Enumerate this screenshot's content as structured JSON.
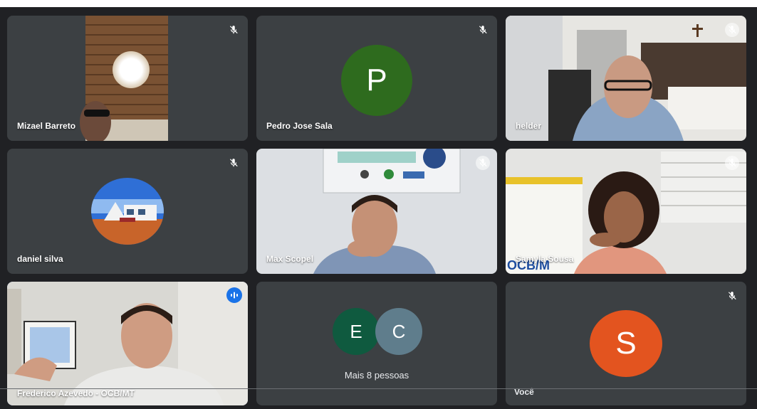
{
  "participants": [
    {
      "name": "Mizael Barreto"
    },
    {
      "name": "Pedro Jose Sala",
      "initial": "P",
      "color": "#2e6b1e"
    },
    {
      "name": "helder"
    },
    {
      "name": "daniel silva"
    },
    {
      "name": "Max Scopel"
    },
    {
      "name": "Samyla Sousa"
    },
    {
      "name": "Frederico Azevedo - OCB/MT"
    },
    {
      "more_label": "Mais 8 pessoas",
      "initials": [
        "E",
        "C"
      ],
      "colors": [
        "#0f5a3f",
        "#5f7d8c"
      ]
    },
    {
      "name": "Você",
      "initial": "S",
      "color": "#e3541f"
    }
  ],
  "icons": {
    "mic_off": "mic-off-icon",
    "speaking": "speaking-indicator-icon"
  },
  "colors": {
    "background": "#202124",
    "tile": "#3c4043",
    "active_border": "#8ab4f8"
  }
}
